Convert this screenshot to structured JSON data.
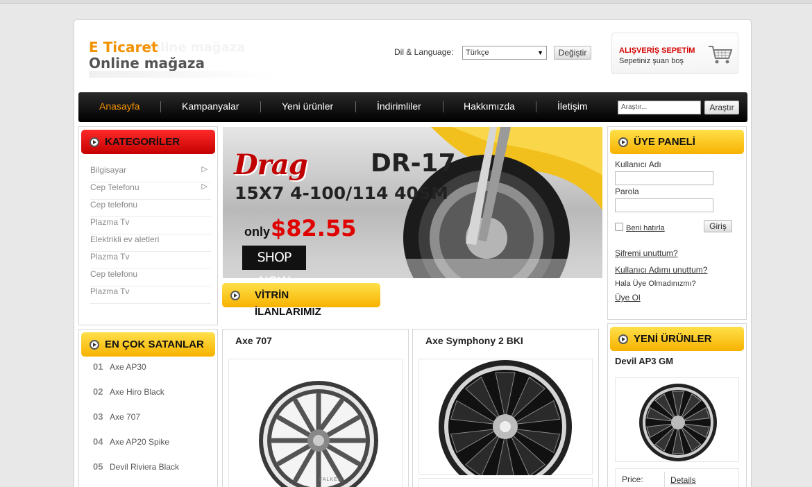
{
  "header": {
    "logo_line1": "E Ticaret",
    "logo_line2": "Online mağaza",
    "language_label": "Dil & Language:",
    "language_selected": "Türkçe",
    "change_button": "Değiştir",
    "cart_title": "ALIŞVERİŞ SEPETİM",
    "cart_status": "Sepetiniz şuan boş"
  },
  "nav": {
    "items": [
      "Anasayfa",
      "Kampanyalar",
      "Yeni ürünler",
      "İndirimliler",
      "Hakkımızda",
      "İletişim"
    ],
    "search_placeholder": "Araştır...",
    "search_button": "Araştır"
  },
  "categories": {
    "title": "KATEGORİLER",
    "items": [
      {
        "label": "Bilgisayar",
        "has_submenu": true
      },
      {
        "label": "Cep Telefonu",
        "has_submenu": true
      },
      {
        "label": "Cep telefonu",
        "has_submenu": false
      },
      {
        "label": "Plazma Tv",
        "has_submenu": false
      },
      {
        "label": "Elektrikli ev aletleri",
        "has_submenu": false
      },
      {
        "label": "Plazma Tv",
        "has_submenu": false
      },
      {
        "label": "Cep telefonu",
        "has_submenu": false
      },
      {
        "label": "Plazma Tv",
        "has_submenu": false
      }
    ]
  },
  "best_sellers": {
    "title": "EN ÇOK SATANLAR",
    "items": [
      {
        "rank": "01",
        "name": "Axe AP30"
      },
      {
        "rank": "02",
        "name": "Axe Hiro Black"
      },
      {
        "rank": "03",
        "name": "Axe 707"
      },
      {
        "rank": "04",
        "name": "Axe AP20 Spike"
      },
      {
        "rank": "05",
        "name": "Devil Riviera Black"
      }
    ]
  },
  "banner": {
    "brand": "Drag",
    "model": "DR-17",
    "size": "15X7 4-100/114 40SM",
    "only": "only",
    "price": "$82.55",
    "cta": "SHOP NOW"
  },
  "showcase": {
    "title": "VİTRİN İLANLARIMIZ",
    "products": [
      {
        "name": "Axe 707",
        "brand_mark": "FALKEN"
      },
      {
        "name": "Axe Symphony 2 BKI"
      }
    ]
  },
  "member_panel": {
    "title": "ÜYE PANELİ",
    "username_label": "Kullanıcı Adı",
    "password_label": "Parola",
    "remember_label": "Beni hatırla",
    "login_button": "Giriş",
    "forgot_password": "Şifremi unuttum?",
    "forgot_username": "Kullanıcı Adımı unuttum?",
    "not_member": "Hala Üye Olmadınızmı?",
    "register": "Üye Ol"
  },
  "new_products": {
    "title": "YENİ ÜRÜNLER",
    "product_name": "Devil AP3 GM",
    "price_label": "Price:",
    "details_link": "Details"
  },
  "colors": {
    "accent_orange": "#f39200",
    "cart_red": "#d40000",
    "category_header_red": "#e00000",
    "header_yellow": "#fcc419",
    "price_red": "#e00000"
  }
}
